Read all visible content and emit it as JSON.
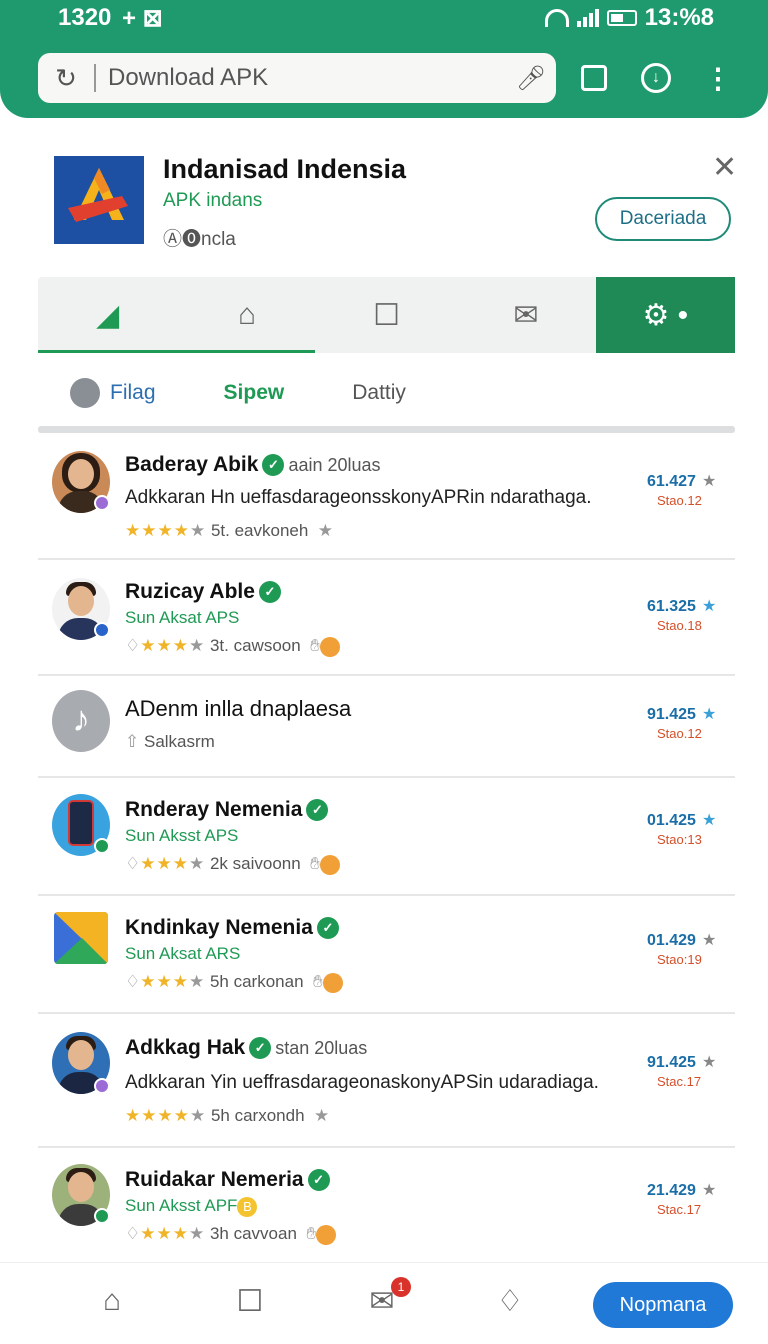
{
  "status_bar": {
    "time": "1320",
    "icons_left": "+ ⊠",
    "battery_text": "13:%8",
    "wifi_icon": "wifi-icon",
    "signal_icon": "signal-icon",
    "battery_icon": "battery-icon"
  },
  "browser": {
    "url": "Download APK",
    "reload_icon": "reload-icon",
    "mic_icon": "mic-icon",
    "accent_color": "#1f9a6e"
  },
  "app": {
    "name": "Indanisad Indensia",
    "subtitle": "APK indans",
    "developer": "Ⓐ⓿ncla",
    "download_label": "Daceriada",
    "close_icon": "close-icon"
  },
  "tabs": [
    {
      "icon": "apps-icon",
      "symbol": "◤"
    },
    {
      "icon": "home-icon",
      "symbol": "⌂"
    },
    {
      "icon": "chat-icon",
      "symbol": "☐"
    },
    {
      "icon": "mail-icon",
      "symbol": "✉"
    },
    {
      "icon": "settings-icon",
      "symbol": "⚙ •",
      "active": true
    }
  ],
  "subtabs": [
    "Filag",
    "Sipew",
    "Dattiy"
  ],
  "items": [
    {
      "name": "Baderay Abik",
      "meta": "aain 20luas",
      "description": "Adkkaran Hn ueffasdarageonsskonyAPRin ndarathaga.",
      "rating_text": "5t. eavkoneh",
      "value": "61.427",
      "sub_value": "Stao.12"
    },
    {
      "name": "Ruzicay Able",
      "category": "Sun Aksat APS",
      "rating_text": "3t. cawsoon",
      "value": "61.325",
      "sub_value": "Stao.18"
    },
    {
      "name": "ADenm inlla dnaplaesa",
      "rating_text": "Salkasrm",
      "value": "91.425",
      "sub_value": "Stao.12"
    },
    {
      "name": "Rnderay Nemenia",
      "category": "Sun Aksst APS",
      "rating_text": "2k saivoonn",
      "value": "01.425",
      "sub_value": "Stao:13"
    },
    {
      "name": "Kndinkay Nemenia",
      "category": "Sun Aksat ARS",
      "rating_text": "5h carkonan",
      "value": "01.429",
      "sub_value": "Stao:19"
    },
    {
      "name": "Adkkag Hak",
      "meta": "stan 20luas",
      "description": "Adkkaran Yin ueffrasdarageonaskonyAPSin udaradiaga.",
      "rating_text": "5h carxondh",
      "value": "91.425",
      "sub_value": "Stac.17"
    },
    {
      "name": "Ruidakar Nemeria",
      "category": "Sun Aksst APF",
      "category_badge": "B",
      "rating_text": "3h cavvoan",
      "value": "21.429",
      "sub_value": "Stac.17"
    }
  ],
  "bottom_nav": {
    "home_icon": "home-icon",
    "search_icon": "search-icon",
    "mail_icon": "mail-icon",
    "notification_count": "1",
    "tag_icon": "tag-icon",
    "primary_label": "Nopmana"
  }
}
